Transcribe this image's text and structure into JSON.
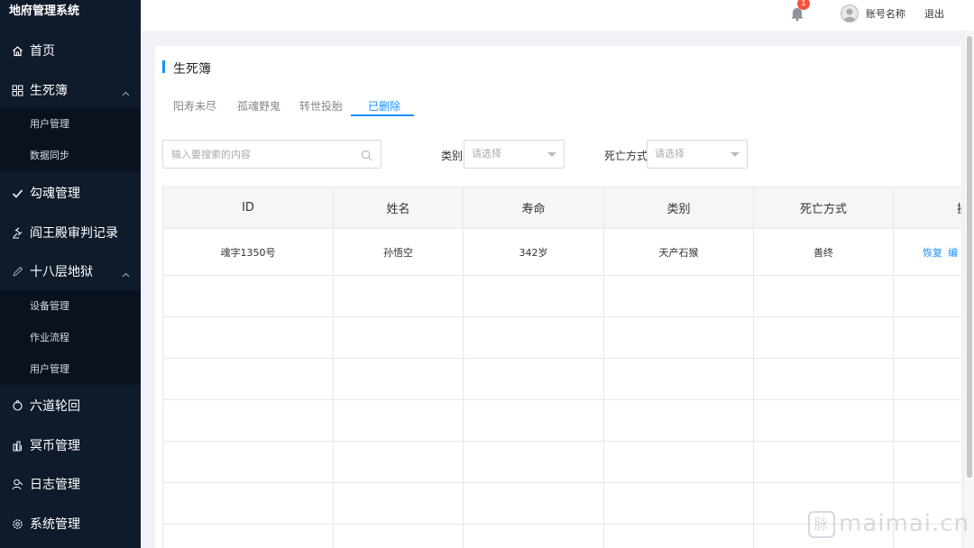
{
  "app": {
    "title": "地府管理系统"
  },
  "sidebar": {
    "items": [
      {
        "label": "首页",
        "icon": "home-icon"
      },
      {
        "label": "生死簿",
        "icon": "grid-icon",
        "expanded": true,
        "children": [
          {
            "label": "用户管理"
          },
          {
            "label": "数据同步"
          }
        ]
      },
      {
        "label": "勾魂管理",
        "icon": "check-icon"
      },
      {
        "label": "阎王殿审判记录",
        "icon": "gavel-icon"
      },
      {
        "label": "十八层地狱",
        "icon": "pen-icon",
        "expanded": true,
        "children": [
          {
            "label": "设备管理"
          },
          {
            "label": "作业流程"
          },
          {
            "label": "用户管理"
          }
        ]
      },
      {
        "label": "六道轮回",
        "icon": "cycle-icon"
      },
      {
        "label": "冥币管理",
        "icon": "coins-icon"
      },
      {
        "label": "日志管理",
        "icon": "person-icon"
      },
      {
        "label": "系统管理",
        "icon": "gear-icon"
      }
    ]
  },
  "topbar": {
    "notification_count": "1",
    "account_name": "账号名称",
    "logout_label": "退出"
  },
  "panel": {
    "title": "生死簿",
    "tabs": [
      {
        "label": "阳寿未尽"
      },
      {
        "label": "孤魂野鬼"
      },
      {
        "label": "转世投胎"
      },
      {
        "label": "已删除",
        "active": true
      }
    ],
    "search": {
      "placeholder": "输入要搜索的内容"
    },
    "filters": {
      "category": {
        "label": "类别",
        "placeholder": "请选择"
      },
      "death_method": {
        "label": "死亡方式",
        "placeholder": "请选择"
      }
    },
    "table": {
      "columns": [
        "ID",
        "姓名",
        "寿命",
        "类别",
        "死亡方式",
        "操"
      ],
      "rows": [
        {
          "id": "魂字1350号",
          "name": "孙悟空",
          "lifespan": "342岁",
          "category": "天产石猴",
          "death_method": "善终",
          "actions": [
            "恢复",
            "编"
          ]
        }
      ]
    }
  },
  "watermark": {
    "glyph": "脉",
    "text": "maimai.cn"
  },
  "colors": {
    "accent": "#1890ff",
    "sidebar_bg": "#0f1a2b",
    "badge": "#f5533d"
  }
}
